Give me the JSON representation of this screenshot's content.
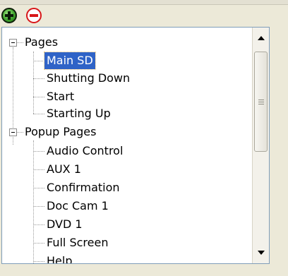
{
  "toolbar": {
    "add_icon": "plus-circle-icon",
    "remove_icon": "minus-circle-icon"
  },
  "tree": {
    "groups": [
      {
        "label": "Pages",
        "expanded": true,
        "children": [
          "Main SD",
          "Shutting Down",
          "Start",
          "Starting Up"
        ]
      },
      {
        "label": "Popup Pages",
        "expanded": true,
        "children": [
          "Audio Control",
          "AUX 1",
          "Confirmation",
          "Doc Cam 1",
          "DVD 1",
          "Full Screen",
          "Help"
        ]
      }
    ],
    "selected": "Main SD"
  },
  "colors": {
    "selection": "#2f63c7",
    "add": "#3fa32c",
    "remove": "#d8171a"
  }
}
